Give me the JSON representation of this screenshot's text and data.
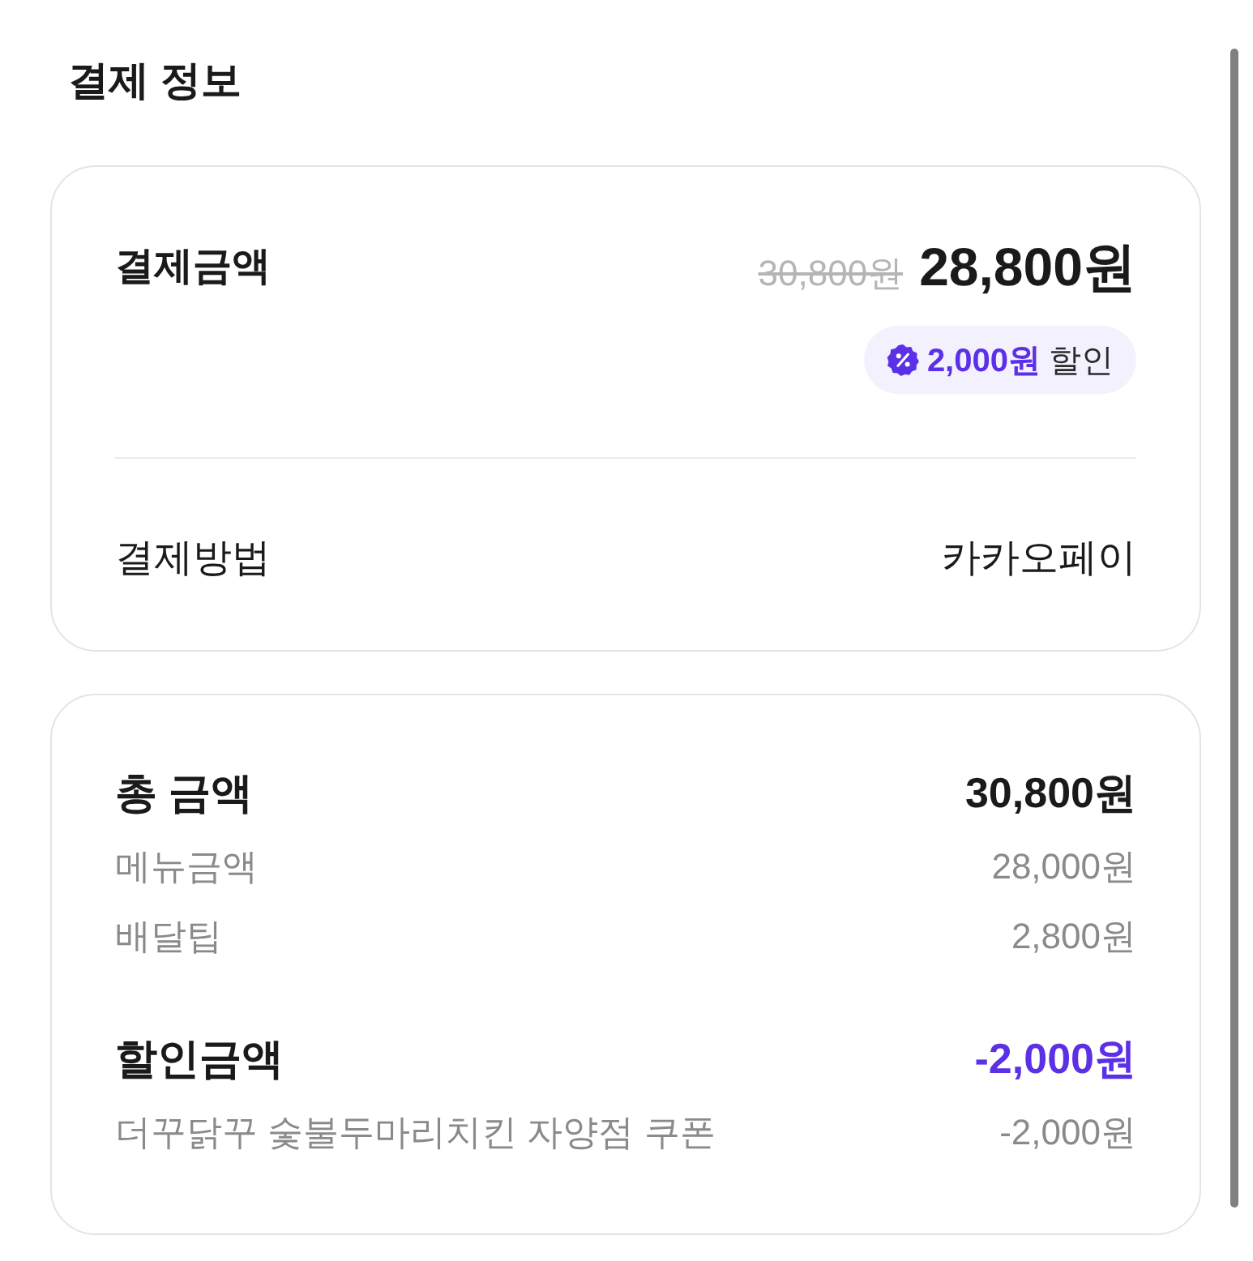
{
  "title": "결제 정보",
  "payment_card": {
    "amount": {
      "label": "결제금액",
      "original_price": "30,800원",
      "price": "28,800원",
      "discount_badge": {
        "amount": "2,000원",
        "text": "할인"
      }
    },
    "method": {
      "label": "결제방법",
      "value": "카카오페이"
    }
  },
  "summary_card": {
    "groups": [
      {
        "kind": "total",
        "label": "총 금액",
        "value": "30,800원",
        "items": [
          {
            "label": "메뉴금액",
            "value": "28,000원"
          },
          {
            "label": "배달팁",
            "value": "2,800원"
          }
        ]
      },
      {
        "kind": "discount",
        "label": "할인금액",
        "value": "-2,000원",
        "items": [
          {
            "label": "더꾸닭꾸 숯불두마리치킨 자양점 쿠폰",
            "value": "-2,000원"
          }
        ]
      }
    ]
  }
}
